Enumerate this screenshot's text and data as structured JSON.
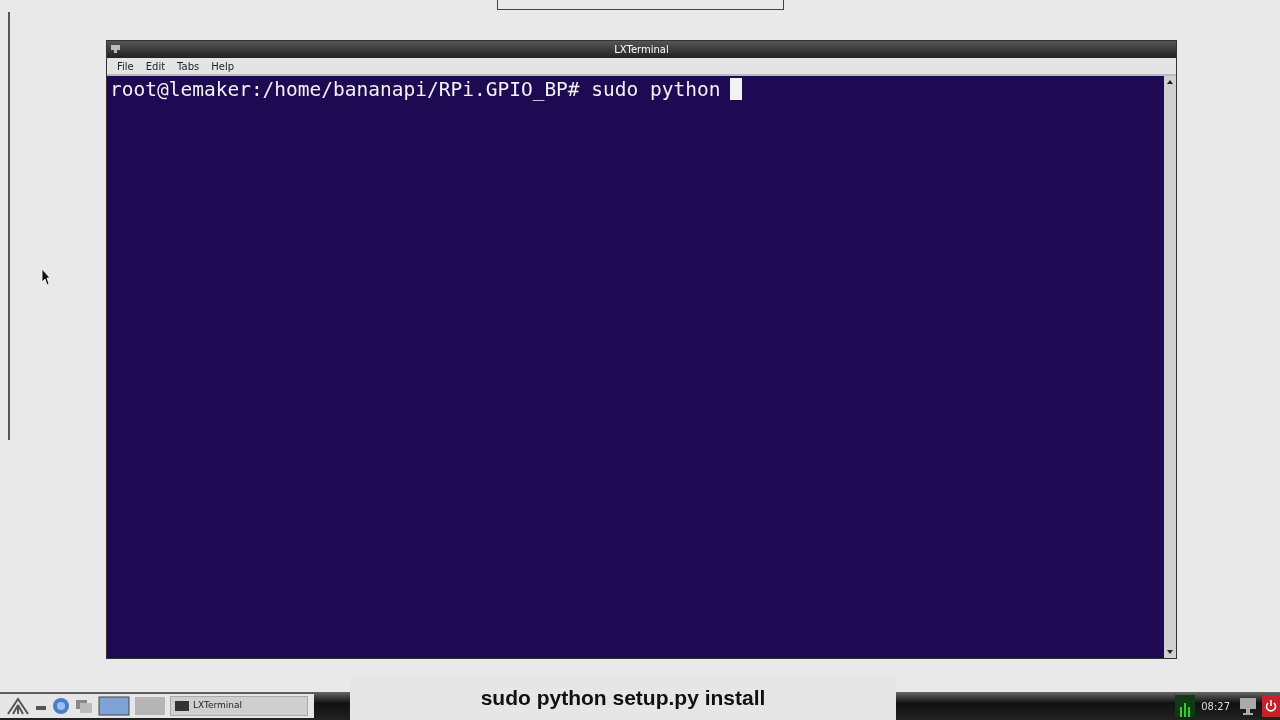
{
  "window": {
    "title": "LXTerminal"
  },
  "menu": [
    {
      "label": "File"
    },
    {
      "label": "Edit"
    },
    {
      "label": "Tabs"
    },
    {
      "label": "Help"
    }
  ],
  "terminal": {
    "prompt": "root@lemaker:/home/bananapi/RPi.GPIO_BP#",
    "command": "sudo python",
    "cursor": true
  },
  "taskbar": {
    "tasks": [
      {
        "label": "LXTerminal"
      }
    ],
    "clock": "08:27"
  },
  "caption": "sudo python setup.py install"
}
